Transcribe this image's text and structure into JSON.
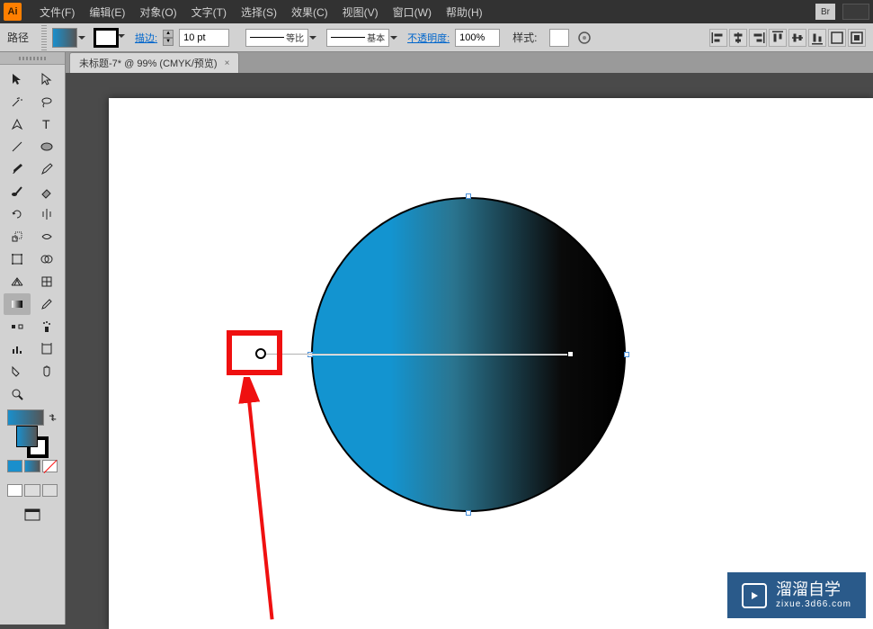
{
  "app": {
    "logo": "Ai"
  },
  "menu": {
    "file": "文件(F)",
    "edit": "编辑(E)",
    "object": "对象(O)",
    "type": "文字(T)",
    "select": "选择(S)",
    "effect": "效果(C)",
    "view": "视图(V)",
    "window": "窗口(W)",
    "help": "帮助(H)",
    "br": "Br"
  },
  "props": {
    "selection_type": "路径",
    "stroke_label": "描边:",
    "stroke_weight": "10 pt",
    "variable_label": "等比",
    "basic_label": "基本",
    "opacity_label": "不透明度:",
    "opacity_value": "100%",
    "style_label": "样式:"
  },
  "document": {
    "tab_title": "未标题-7* @ 99% (CMYK/预览)"
  },
  "colors": {
    "gradient_start": "#1394d0",
    "gradient_end": "#000000",
    "annotation_red": "#ef1010",
    "watermark_bg": "#2a5a8a"
  },
  "watermark": {
    "title": "溜溜自学",
    "subtitle": "zixue.3d66.com"
  }
}
